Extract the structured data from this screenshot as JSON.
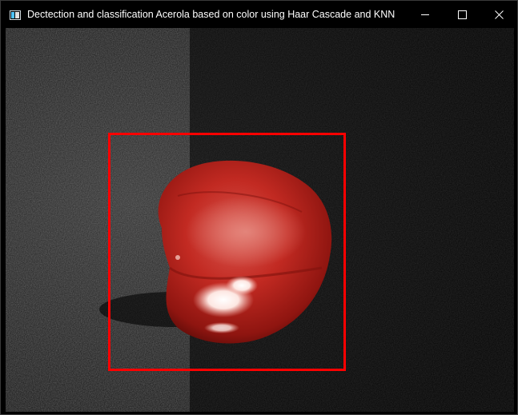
{
  "window": {
    "title": "Dectection and classification Acerola based on color using Haar Cascade and KNN",
    "app_icon": "opencv-window-icon",
    "controls": {
      "minimize": "minimize-icon",
      "maximize": "maximize-icon",
      "close": "close-icon"
    }
  },
  "viewer": {
    "image_subject": "acerola fruit on dark fabric",
    "detection": {
      "color": "#ff0000"
    }
  }
}
